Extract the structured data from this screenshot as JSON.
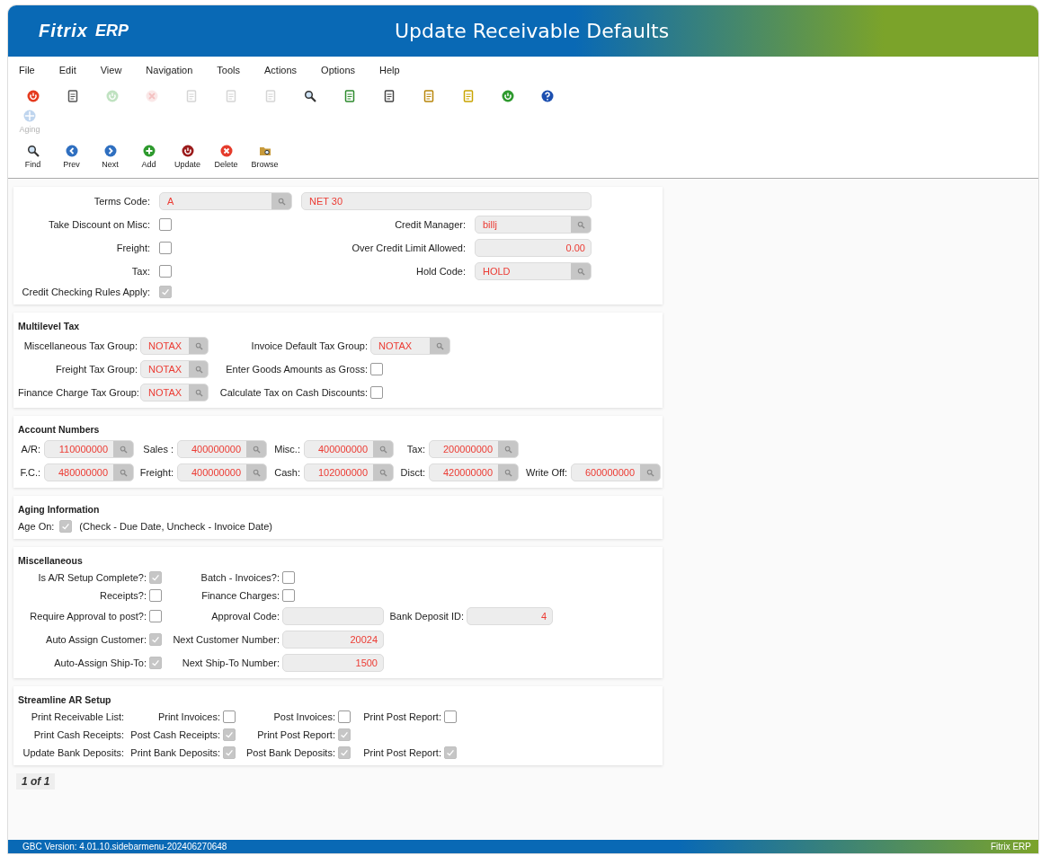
{
  "header": {
    "logo_brand": "Fitrix",
    "logo_product": "ERP",
    "title": "Update Receivable Defaults"
  },
  "menu": [
    "File",
    "Edit",
    "View",
    "Navigation",
    "Tools",
    "Actions",
    "Options",
    "Help"
  ],
  "toolbar": [
    {
      "disabled": false
    },
    {
      "disabled": false
    },
    {
      "disabled": true
    },
    {
      "disabled": true
    },
    {
      "disabled": true
    },
    {
      "disabled": true
    },
    {
      "disabled": true
    },
    {
      "disabled": false
    },
    {
      "disabled": false
    },
    {
      "disabled": false
    },
    {
      "disabled": false
    },
    {
      "disabled": false
    },
    {
      "disabled": false
    },
    {
      "disabled": false
    }
  ],
  "aging_button": {
    "label": "Aging",
    "disabled": true
  },
  "nav_buttons": [
    "Find",
    "Prev",
    "Next",
    "Add",
    "Update",
    "Delete",
    "Browse"
  ],
  "sections": [
    {
      "rows": [
        [
          {
            "kind": "label",
            "text": "Terms Code:"
          },
          {
            "kind": "lookup",
            "value": "A"
          },
          {
            "kind": "text-field",
            "value": "NET 30"
          }
        ],
        [
          {
            "kind": "label",
            "text": "Take Discount on Misc:"
          },
          {
            "kind": "checkbox",
            "checked": false
          },
          {
            "kind": "label",
            "text": "Credit Manager:"
          },
          {
            "kind": "lookup",
            "value": "billj"
          }
        ],
        [
          {
            "kind": "label",
            "text": "Freight:"
          },
          {
            "kind": "checkbox",
            "checked": false
          },
          {
            "kind": "label",
            "text": "Over Credit Limit Allowed:"
          },
          {
            "kind": "number-field",
            "value": "0.00"
          }
        ],
        [
          {
            "kind": "label",
            "text": "Tax:"
          },
          {
            "kind": "checkbox",
            "checked": false
          },
          {
            "kind": "label",
            "text": "Hold Code:"
          },
          {
            "kind": "lookup",
            "value": "HOLD"
          }
        ],
        [
          {
            "kind": "label",
            "text": "Credit Checking Rules Apply:"
          },
          {
            "kind": "checkbox",
            "checked": true
          }
        ]
      ]
    },
    {
      "title": "Multilevel Tax",
      "rows": [
        [
          {
            "kind": "label",
            "text": "Miscellaneous Tax Group:"
          },
          {
            "kind": "lookup",
            "value": "NOTAX"
          },
          {
            "kind": "label",
            "text": "Invoice Default Tax Group:"
          },
          {
            "kind": "lookup",
            "value": "NOTAX"
          }
        ],
        [
          {
            "kind": "label",
            "text": "Freight Tax Group:"
          },
          {
            "kind": "lookup",
            "value": "NOTAX"
          },
          {
            "kind": "label",
            "text": "Enter Goods Amounts as Gross:"
          },
          {
            "kind": "checkbox",
            "checked": false
          }
        ],
        [
          {
            "kind": "label",
            "text": "Finance Charge Tax Group:"
          },
          {
            "kind": "lookup",
            "value": "NOTAX"
          },
          {
            "kind": "label",
            "text": "Calculate Tax on Cash Discounts:"
          },
          {
            "kind": "checkbox",
            "checked": false
          }
        ]
      ]
    },
    {
      "title": "Account Numbers",
      "rows": [
        [
          {
            "kind": "label",
            "text": "A/R:"
          },
          {
            "kind": "number-lookup",
            "value": "110000000"
          },
          {
            "kind": "label",
            "text": "Sales :"
          },
          {
            "kind": "number-lookup",
            "value": "400000000"
          },
          {
            "kind": "label",
            "text": "Misc.:"
          },
          {
            "kind": "number-lookup",
            "value": "400000000"
          },
          {
            "kind": "label",
            "text": "Tax:"
          },
          {
            "kind": "number-lookup",
            "value": "200000000"
          }
        ],
        [
          {
            "kind": "label",
            "text": "F.C.:"
          },
          {
            "kind": "number-lookup",
            "value": "480000000"
          },
          {
            "kind": "label",
            "text": "Freight:"
          },
          {
            "kind": "number-lookup",
            "value": "400000000"
          },
          {
            "kind": "label",
            "text": "Cash:"
          },
          {
            "kind": "number-lookup",
            "value": "102000000"
          },
          {
            "kind": "label",
            "text": "Disct:"
          },
          {
            "kind": "number-lookup",
            "value": "420000000"
          },
          {
            "kind": "label",
            "text": "Write Off:"
          },
          {
            "kind": "number-lookup",
            "value": "600000000"
          }
        ]
      ]
    },
    {
      "title": "Aging Information",
      "rows": [
        [
          {
            "kind": "label",
            "text": "Age On:"
          },
          {
            "kind": "checkbox",
            "checked": true
          },
          {
            "kind": "note",
            "text": "(Check - Due Date, Uncheck - Invoice Date)"
          }
        ]
      ]
    },
    {
      "title": "Miscellaneous",
      "rows": [
        [
          {
            "kind": "label",
            "text": "Is A/R Setup Complete?:"
          },
          {
            "kind": "checkbox",
            "checked": true
          },
          {
            "kind": "label",
            "text": "Batch - Invoices?:"
          },
          {
            "kind": "checkbox",
            "checked": false
          }
        ],
        [
          {
            "kind": "label",
            "text": "Receipts?:"
          },
          {
            "kind": "checkbox",
            "checked": false
          },
          {
            "kind": "label",
            "text": "Finance Charges:"
          },
          {
            "kind": "checkbox",
            "checked": false
          }
        ],
        [
          {
            "kind": "label",
            "text": "Require Approval to post?:"
          },
          {
            "kind": "checkbox",
            "checked": false
          },
          {
            "kind": "label",
            "text": "Approval Code:"
          },
          {
            "kind": "text-field"
          },
          {
            "kind": "label",
            "text": "Bank Deposit ID:"
          },
          {
            "kind": "number-field",
            "value": "4"
          }
        ],
        [
          {
            "kind": "label",
            "text": "Auto Assign Customer:"
          },
          {
            "kind": "checkbox",
            "checked": true
          },
          {
            "kind": "label",
            "text": "Next Customer Number:"
          },
          {
            "kind": "number-field",
            "value": "20024"
          }
        ],
        [
          {
            "kind": "label",
            "text": "Auto-Assign Ship-To:"
          },
          {
            "kind": "checkbox",
            "checked": true
          },
          {
            "kind": "label",
            "text": "Next Ship-To Number:"
          },
          {
            "kind": "number-field",
            "value": "1500"
          }
        ]
      ]
    },
    {
      "title": "Streamline AR Setup",
      "rows": [
        [
          {
            "kind": "label",
            "text": "Print Receivable List:"
          },
          {
            "kind": "label",
            "text": "Print Invoices:"
          },
          {
            "kind": "checkbox",
            "checked": false
          },
          {
            "kind": "label",
            "text": "Post Invoices:"
          },
          {
            "kind": "checkbox",
            "checked": false
          },
          {
            "kind": "label",
            "text": "Print Post Report:"
          },
          {
            "kind": "checkbox",
            "checked": false
          }
        ],
        [
          {
            "kind": "label",
            "text": "Print Cash Receipts:"
          },
          {
            "kind": "label",
            "text": "Post Cash Receipts:"
          },
          {
            "kind": "checkbox",
            "checked": true
          },
          {
            "kind": "label",
            "text": "Print Post Report:"
          },
          {
            "kind": "checkbox",
            "checked": true
          }
        ],
        [
          {
            "kind": "label",
            "text": "Update Bank Deposits:"
          },
          {
            "kind": "label",
            "text": "Print Bank Deposits:"
          },
          {
            "kind": "checkbox",
            "checked": true
          },
          {
            "kind": "label",
            "text": "Post Bank Deposits:"
          },
          {
            "kind": "checkbox",
            "checked": true
          },
          {
            "kind": "label",
            "text": "Print Post Report:"
          },
          {
            "kind": "checkbox",
            "checked": true
          }
        ]
      ]
    }
  ],
  "pager": "1 of 1",
  "footer": {
    "version": "GBC Version: 4.01.10.sidebarmenu-202406270648",
    "product": "Fitrix ERP"
  }
}
